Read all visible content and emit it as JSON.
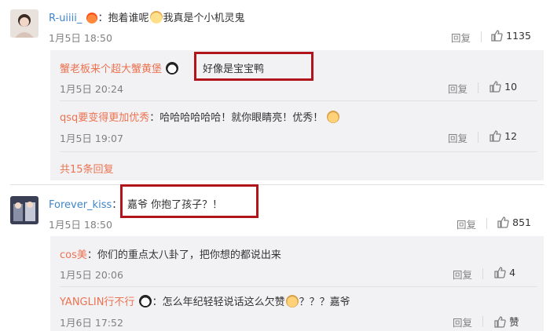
{
  "c1": {
    "user": "R-uiiii_",
    "text_a": "：抱着谁呢",
    "text_b": "我真是个小机灵鬼",
    "time": "1月5日 18:50",
    "reply": "回复",
    "likes": "1135"
  },
  "s1": {
    "user": "蟹老板来个超大蟹黄堡",
    "text": "好像是宝宝鸭",
    "time": "1月5日 20:24",
    "reply": "回复",
    "likes": "10"
  },
  "s2": {
    "user": "qsq要变得更加优秀",
    "text": "：哈哈哈哈哈哈！就你眼睛亮！优秀！",
    "time": "1月5日 19:07",
    "reply": "回复",
    "likes": "12"
  },
  "more": "共15条回复",
  "c2": {
    "user": "Forever_kiss",
    "text": "嘉爷  你抱了孩子？！",
    "time": "1月5日 18:50",
    "reply": "回复",
    "likes": "851"
  },
  "s3": {
    "user": "cos美",
    "text": "：你们的重点太八卦了，把你想的都说出来",
    "time": "1月5日 20:06",
    "reply": "回复",
    "likes": "4"
  },
  "s4": {
    "user": "YANGLIN行不行",
    "text_a": "：怎么年纪轻轻说话这么欠赞",
    "text_b": "？？？嘉爷",
    "time": "1月6日 17:52",
    "reply": "回复",
    "likes": "赞"
  },
  "colors": {
    "username_orange": "#eb7350",
    "username_blue": "#3e86c9",
    "highlight_border": "#b1151b",
    "subcomment_bg": "#f2f2f5"
  }
}
